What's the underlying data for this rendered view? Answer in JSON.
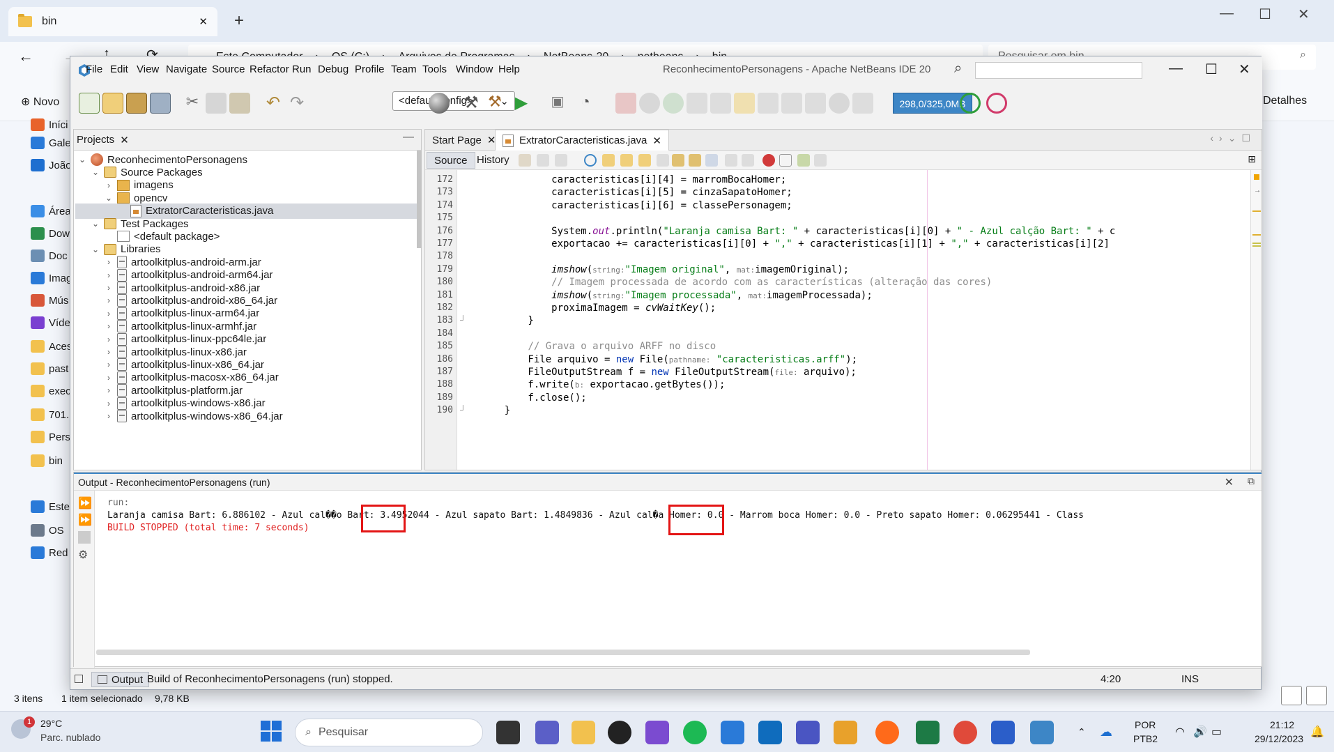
{
  "explorer": {
    "tab_title": "bin",
    "path": [
      "Este Computador",
      "OS (C:)",
      "Arquivos de Programas",
      "NetBeans-20",
      "netbeans",
      "bin"
    ],
    "search_placeholder": "Pesquisar em bin",
    "new_label": "Novo",
    "details_label": "Detalhes",
    "sidebar": [
      {
        "label": "Iníci",
        "icon": "home-icon",
        "color": "#e8632b"
      },
      {
        "label": "Gale",
        "icon": "gallery-icon",
        "color": "#2a7ad8"
      },
      {
        "label": "João",
        "icon": "onedrive-icon",
        "color": "#1e6fd0"
      },
      {
        "label": "Área",
        "icon": "desktop-icon",
        "color": "#3b8ee6"
      },
      {
        "label": "Dow",
        "icon": "download-icon",
        "color": "#2c8f4d"
      },
      {
        "label": "Doc",
        "icon": "documents-icon",
        "color": "#6c8fb3"
      },
      {
        "label": "Imag",
        "icon": "images-icon",
        "color": "#2a7ad8"
      },
      {
        "label": "Mús",
        "icon": "music-icon",
        "color": "#d8573a"
      },
      {
        "label": "Víde",
        "icon": "video-icon",
        "color": "#7a3fd1"
      },
      {
        "label": "Aces",
        "icon": "folder-icon",
        "color": "#f2c14e"
      },
      {
        "label": "past",
        "icon": "folder-icon",
        "color": "#f2c14e"
      },
      {
        "label": "exec",
        "icon": "folder-icon",
        "color": "#f2c14e"
      },
      {
        "label": "701.",
        "icon": "folder-icon",
        "color": "#f2c14e"
      },
      {
        "label": "Pers",
        "icon": "folder-icon",
        "color": "#f2c14e"
      },
      {
        "label": "bin",
        "icon": "folder-icon",
        "color": "#f2c14e"
      },
      {
        "label": "Este",
        "icon": "computer-icon",
        "color": "#2a7ad8"
      },
      {
        "label": "OS",
        "icon": "drive-icon",
        "color": "#6c7a8c"
      },
      {
        "label": "Red",
        "icon": "network-icon",
        "color": "#2a7ad8"
      }
    ],
    "status_items": "3 itens",
    "status_selected": "1 item selecionado",
    "status_size": "9,78 KB"
  },
  "netbeans": {
    "menu": [
      "File",
      "Edit",
      "View",
      "Navigate",
      "Source",
      "Refactor",
      "Run",
      "Debug",
      "Profile",
      "Team",
      "Tools",
      "Window",
      "Help"
    ],
    "title": "ReconhecimentoPersonagens - Apache NetBeans IDE 20",
    "config": "<default config>",
    "memory": "298,0/325,0MB",
    "projects": {
      "tab": "Projects",
      "tree": [
        {
          "label": "ReconhecimentoPersonagens",
          "indent": 0,
          "icon": "project",
          "chev": "⌄"
        },
        {
          "label": "Source Packages",
          "indent": 1,
          "icon": "src",
          "chev": "⌄"
        },
        {
          "label": "imagens",
          "indent": 2,
          "icon": "pkg",
          "chev": "›"
        },
        {
          "label": "opencv",
          "indent": 2,
          "icon": "pkg",
          "chev": "⌄"
        },
        {
          "label": "ExtratorCaracteristicas.java",
          "indent": 3,
          "icon": "java",
          "chev": "",
          "selected": true
        },
        {
          "label": "Test Packages",
          "indent": 1,
          "icon": "src",
          "chev": "⌄"
        },
        {
          "label": "<default package>",
          "indent": 2,
          "icon": "pkg-empty",
          "chev": ""
        },
        {
          "label": "Libraries",
          "indent": 1,
          "icon": "src",
          "chev": "⌄"
        },
        {
          "label": "artoolkitplus-android-arm.jar",
          "indent": 2,
          "icon": "jar",
          "chev": "›"
        },
        {
          "label": "artoolkitplus-android-arm64.jar",
          "indent": 2,
          "icon": "jar",
          "chev": "›"
        },
        {
          "label": "artoolkitplus-android-x86.jar",
          "indent": 2,
          "icon": "jar",
          "chev": "›"
        },
        {
          "label": "artoolkitplus-android-x86_64.jar",
          "indent": 2,
          "icon": "jar",
          "chev": "›"
        },
        {
          "label": "artoolkitplus-linux-arm64.jar",
          "indent": 2,
          "icon": "jar",
          "chev": "›"
        },
        {
          "label": "artoolkitplus-linux-armhf.jar",
          "indent": 2,
          "icon": "jar",
          "chev": "›"
        },
        {
          "label": "artoolkitplus-linux-ppc64le.jar",
          "indent": 2,
          "icon": "jar",
          "chev": "›"
        },
        {
          "label": "artoolkitplus-linux-x86.jar",
          "indent": 2,
          "icon": "jar",
          "chev": "›"
        },
        {
          "label": "artoolkitplus-linux-x86_64.jar",
          "indent": 2,
          "icon": "jar",
          "chev": "›"
        },
        {
          "label": "artoolkitplus-macosx-x86_64.jar",
          "indent": 2,
          "icon": "jar",
          "chev": "›"
        },
        {
          "label": "artoolkitplus-platform.jar",
          "indent": 2,
          "icon": "jar",
          "chev": "›"
        },
        {
          "label": "artoolkitplus-windows-x86.jar",
          "indent": 2,
          "icon": "jar",
          "chev": "›"
        },
        {
          "label": "artoolkitplus-windows-x86_64.jar",
          "indent": 2,
          "icon": "jar",
          "chev": "›"
        }
      ]
    },
    "editor": {
      "tabs": [
        "Start Page",
        "ExtratorCaracteristicas.java"
      ],
      "source_label": "Source",
      "history_label": "History",
      "lines": [
        {
          "n": "172",
          "html": "            caracteristicas[i][4] = marromBocaHomer;"
        },
        {
          "n": "173",
          "html": "            caracteristicas[i][5] = cinzaSapatoHomer;"
        },
        {
          "n": "174",
          "html": "            caracteristicas[i][6] = classePersonagem;"
        },
        {
          "n": "175",
          "html": ""
        },
        {
          "n": "176",
          "html": "            System.<span class=\"fieldst\">out</span>.println(<span class=\"str\">\"Laranja camisa Bart: \"</span> + caracteristicas[i][0] + <span class=\"str\">\" - Azul calção Bart: \"</span> + c"
        },
        {
          "n": "177",
          "html": "            exportacao += caracteristicas[i][0] + <span class=\"str\">\",\"</span> + caracteristicas[i][1] + <span class=\"str\">\",\"</span> + caracteristicas[i][2]"
        },
        {
          "n": "178",
          "html": ""
        },
        {
          "n": "179",
          "html": "            <span class=\"it\">imshow</span>(<span class=\"hint\">string:</span><span class=\"str\">\"Imagem original\"</span>, <span class=\"hint\">mat:</span>imagemOriginal);"
        },
        {
          "n": "180",
          "html": "            <span class=\"cm\">// Imagem processada de acordo com as características (alteração das cores)</span>"
        },
        {
          "n": "181",
          "html": "            <span class=\"it\">imshow</span>(<span class=\"hint\">string:</span><span class=\"str\">\"Imagem processada\"</span>, <span class=\"hint\">mat:</span>imagemProcessada);"
        },
        {
          "n": "182",
          "html": "            proximaImagem = <span class=\"it\">cvWaitKey</span>();"
        },
        {
          "n": "183",
          "html": "        }"
        },
        {
          "n": "184",
          "html": ""
        },
        {
          "n": "185",
          "html": "        <span class=\"cm\">// Grava o arquivo ARFF no disco</span>"
        },
        {
          "n": "186",
          "html": "        File arquivo = <span class=\"kw\">new</span> File(<span class=\"hint\">pathname:</span> <span class=\"str\">\"caracteristicas.arff\"</span>);"
        },
        {
          "n": "187",
          "html": "        FileOutputStream f = <span class=\"kw\">new</span> FileOutputStream(<span class=\"hint\">file:</span> arquivo);"
        },
        {
          "n": "188",
          "html": "        f.write(<span class=\"hint\">b:</span> exportacao.getBytes());"
        },
        {
          "n": "189",
          "html": "        f.close();"
        },
        {
          "n": "190",
          "html": "    }"
        }
      ]
    },
    "output": {
      "title": "Output - ReconhecimentoPersonagens (run)",
      "lines": [
        "run:",
        "Laranja camisa Bart: 6.886102 - Azul cal��o Bart: 3.4952044 - Azul sapato Bart: 1.4849836 - Azul cal�a Homer: 0.0 - Marrom boca Homer: 0.0 - Preto sapato Homer: 0.06295441 - Class",
        "BUILD STOPPED (total time: 7 seconds)"
      ]
    },
    "status": {
      "output_tab": "Output",
      "message": "Build of ReconhecimentoPersonagens (run) stopped.",
      "position": "4:20",
      "mode": "INS"
    }
  },
  "taskbar": {
    "weather_temp": "29°C",
    "weather_desc": "Parc. nublado",
    "weather_badge": "1",
    "search_placeholder": "Pesquisar",
    "lang": "POR",
    "layout": "PTB2",
    "time": "21:12",
    "date": "29/12/2023",
    "apps": [
      {
        "name": "file-explorer-icon",
        "color": "#333333"
      },
      {
        "name": "teams-icon",
        "color": "#5b5fc7"
      },
      {
        "name": "folder-app-icon",
        "color": "#f2c14e"
      },
      {
        "name": "dell-icon",
        "color": "#222222"
      },
      {
        "name": "visual-studio-icon",
        "color": "#7b4bd0"
      },
      {
        "name": "spotify-icon",
        "color": "#1db954"
      },
      {
        "name": "store-icon",
        "color": "#2a7ad8"
      },
      {
        "name": "outlook-icon",
        "color": "#0f6cbd"
      },
      {
        "name": "teams-new-icon",
        "color": "#4a55c2"
      },
      {
        "name": "paint-icon",
        "color": "#e8a12b"
      },
      {
        "name": "firefox-icon",
        "color": "#ff6a1a"
      },
      {
        "name": "excel-icon",
        "color": "#1d7a45"
      },
      {
        "name": "chrome-icon",
        "color": "#e04a3a"
      },
      {
        "name": "word-icon",
        "color": "#2b5ec9"
      },
      {
        "name": "netbeans-icon",
        "color": "#3d86c6"
      }
    ]
  }
}
